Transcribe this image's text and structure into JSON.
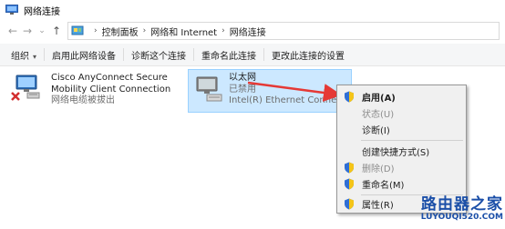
{
  "window": {
    "title": "网络连接"
  },
  "address": {
    "crumbs": [
      "控制面板",
      "网络和 Internet",
      "网络连接"
    ]
  },
  "toolbar": {
    "organize": "组织",
    "enable_device": "启用此网络设备",
    "diagnose": "诊断这个连接",
    "rename": "重命名此连接",
    "change_settings": "更改此连接的设置"
  },
  "connections": [
    {
      "name_line1": "Cisco AnyConnect Secure",
      "name_line2": "Mobility Client Connection",
      "status": "网络电缆被拔出"
    },
    {
      "name": "以太网",
      "status": "已禁用",
      "device": "Intel(R) Ethernet Connection"
    }
  ],
  "context_menu": {
    "items": [
      {
        "label": "启用(A)",
        "bold": true,
        "disabled": false,
        "shield": true
      },
      {
        "label": "状态(U)",
        "bold": false,
        "disabled": true,
        "shield": false
      },
      {
        "label": "诊断(I)",
        "bold": false,
        "disabled": false,
        "shield": false
      },
      {
        "label": "创建快捷方式(S)",
        "bold": false,
        "disabled": false,
        "shield": false
      },
      {
        "label": "删除(D)",
        "bold": false,
        "disabled": true,
        "shield": true
      },
      {
        "label": "重命名(M)",
        "bold": false,
        "disabled": false,
        "shield": true
      },
      {
        "label": "属性(R)",
        "bold": false,
        "disabled": false,
        "shield": true
      }
    ]
  },
  "watermark": {
    "main": "路由器之家",
    "url": "LUYOUQI520.COM"
  },
  "colors": {
    "selection": "#cce8ff",
    "arrow": "#e53935",
    "watermark": "#1b4fa8"
  }
}
